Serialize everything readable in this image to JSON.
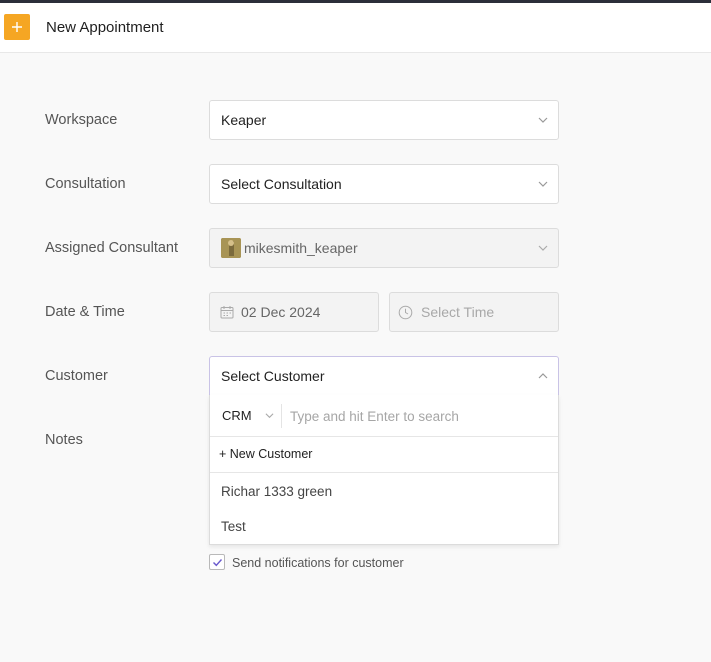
{
  "header": {
    "title": "New Appointment",
    "add_icon": "plus-icon",
    "accent": "#f5a623"
  },
  "form": {
    "workspace": {
      "label": "Workspace",
      "value": "Keaper"
    },
    "consultation": {
      "label": "Consultation",
      "value": "Select Consultation"
    },
    "consultant": {
      "label": "Assigned Consultant",
      "value": "mikesmith_keaper"
    },
    "datetime": {
      "label": "Date & Time",
      "date": "02 Dec 2024",
      "time_placeholder": "Select Time"
    },
    "customer": {
      "label": "Customer",
      "value": "Select Customer"
    },
    "notes": {
      "label": "Notes"
    }
  },
  "customer_dropdown": {
    "source": "CRM",
    "search_placeholder": "Type and hit Enter to search",
    "new_customer": "+ New Customer",
    "options": [
      "Richar 1333 green",
      "Test"
    ]
  },
  "notify": {
    "label": "Send notifications for customer",
    "checked": true
  }
}
